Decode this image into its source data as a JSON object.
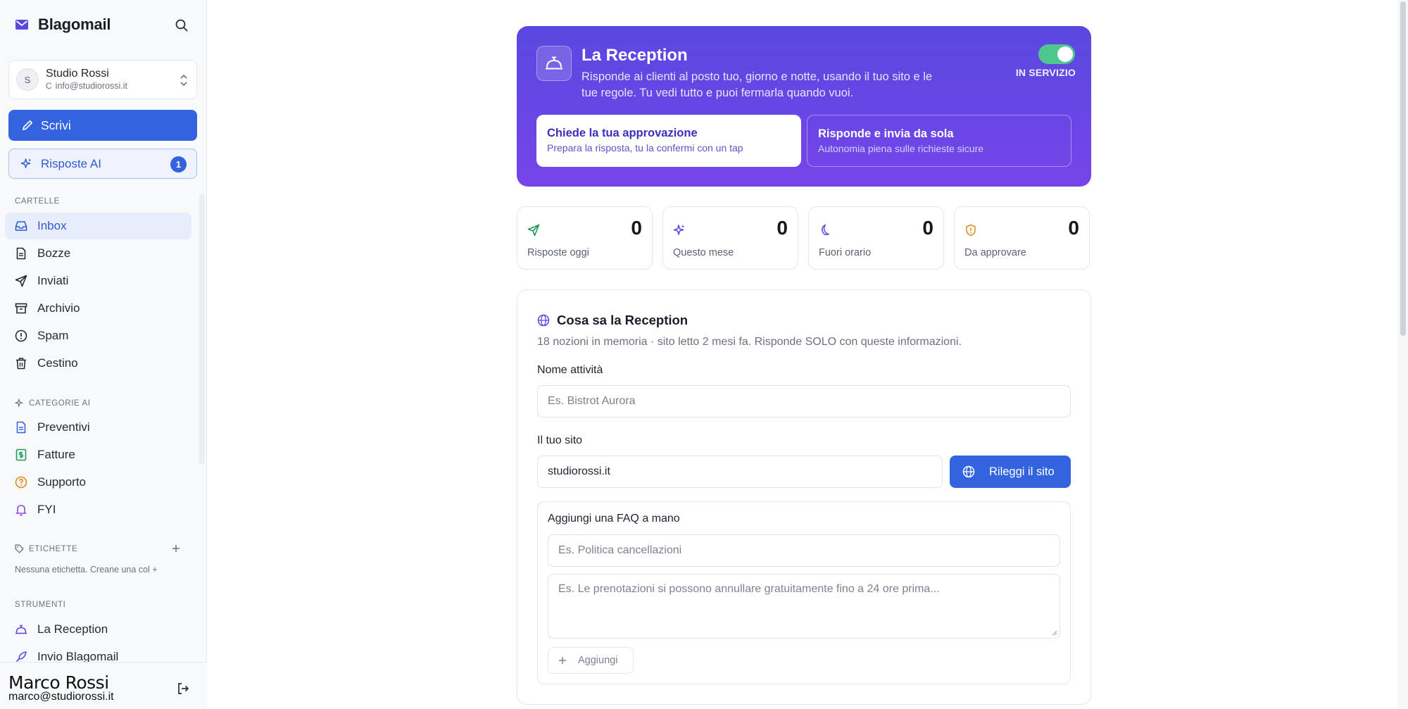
{
  "app": {
    "name": "Blagomail"
  },
  "account": {
    "avatar_initial": "S",
    "name": "Studio Rossi",
    "email_prefix": "C",
    "email": "info@studiorossi.it"
  },
  "compose_label": "Scrivi",
  "ai_replies": {
    "label": "Risposte AI",
    "badge": "1"
  },
  "sections": {
    "folders": "CARTELLE",
    "ai_categories": "CATEGORIE AI",
    "labels": "ETICHETTE",
    "tools": "STRUMENTI"
  },
  "folders": [
    {
      "label": "Inbox",
      "icon": "inbox-icon",
      "active": true
    },
    {
      "label": "Bozze",
      "icon": "file-icon"
    },
    {
      "label": "Inviati",
      "icon": "send-icon"
    },
    {
      "label": "Archivio",
      "icon": "archive-icon"
    },
    {
      "label": "Spam",
      "icon": "alert-circle-icon"
    },
    {
      "label": "Cestino",
      "icon": "trash-icon"
    }
  ],
  "ai_categories": [
    {
      "label": "Preventivi",
      "icon": "file-text-icon",
      "color": "#3463e0"
    },
    {
      "label": "Fatture",
      "icon": "dollar-receipt-icon",
      "color": "#1e9a5b"
    },
    {
      "label": "Supporto",
      "icon": "help-circle-icon",
      "color": "#e08a1c"
    },
    {
      "label": "FYI",
      "icon": "bell-icon",
      "color": "#8b4be0"
    }
  ],
  "labels_empty": "Nessuna etichetta. Creane una col +",
  "tools": [
    {
      "label": "La Reception",
      "icon": "concierge-bell-icon"
    },
    {
      "label": "Invio Blagomail",
      "icon": "rocket-icon"
    }
  ],
  "user": {
    "name": "Marco Rossi",
    "email": "marco@studiorossi.it"
  },
  "reception": {
    "title": "La Reception",
    "description": "Risponde ai clienti al posto tuo, giorno e notte, usando il tuo sito e le tue regole. Tu vedi tutto e puoi fermarla quando vuoi.",
    "status_label": "IN SERVIZIO",
    "enabled": true,
    "modes": [
      {
        "title": "Chiede la tua approvazione",
        "subtitle": "Prepara la risposta, tu la confermi con un tap",
        "selected": true
      },
      {
        "title": "Risponde e invia da sola",
        "subtitle": "Autonomia piena sulle richieste sicure",
        "selected": false
      }
    ]
  },
  "stats": [
    {
      "label": "Risposte oggi",
      "value": "0",
      "icon": "send-icon",
      "color": "#1e9a5b"
    },
    {
      "label": "Questo mese",
      "value": "0",
      "icon": "sparkles-icon",
      "color": "#5a48df"
    },
    {
      "label": "Fuori orario",
      "value": "0",
      "icon": "moon-icon",
      "color": "#5a48df"
    },
    {
      "label": "Da approvare",
      "value": "0",
      "icon": "shield-alert-icon",
      "color": "#e08a1c"
    }
  ],
  "knowledge": {
    "title": "Cosa sa la Reception",
    "subtitle": "18 nozioni in memoria · sito letto 2 mesi fa. Risponde SOLO con queste informazioni.",
    "business_name_label": "Nome attività",
    "business_name_placeholder": "Es. Bistrot Aurora",
    "site_label": "Il tuo sito",
    "site_value": "studiorossi.it",
    "reload_label": "Rileggi il sito",
    "faq_title": "Aggiungi una FAQ a mano",
    "faq_question_placeholder": "Es. Politica cancellazioni",
    "faq_answer_placeholder": "Es. Le prenotazioni si possono annullare gratuitamente fino a 24 ore prima...",
    "add_label": "Aggiungi"
  }
}
